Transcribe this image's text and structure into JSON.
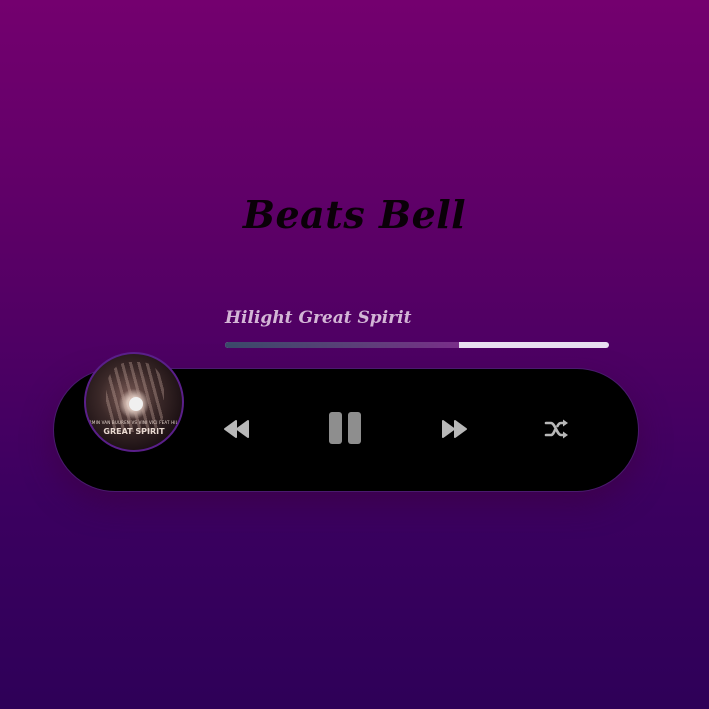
{
  "app": {
    "title": "Beats Bell"
  },
  "track": {
    "title": "Hilight Great Spirit",
    "progress_percent": 61
  },
  "album_art": {
    "small_text": "ARMIN VAN BUUREN VS VINI VICI FEAT HILIGHT TRIBE",
    "big_text": "GREAT SPIRIT"
  },
  "controls": {
    "prev_icon": "rewind-icon",
    "play_pause_icon": "pause-icon",
    "next_icon": "fast-forward-icon",
    "shuffle_icon": "shuffle-icon"
  },
  "colors": {
    "background_top": "#74006f",
    "background_bottom": "#2e0058",
    "player_bar": "#000000",
    "icon_color": "#b8b8b8",
    "track_title": "#d3b6d6"
  }
}
